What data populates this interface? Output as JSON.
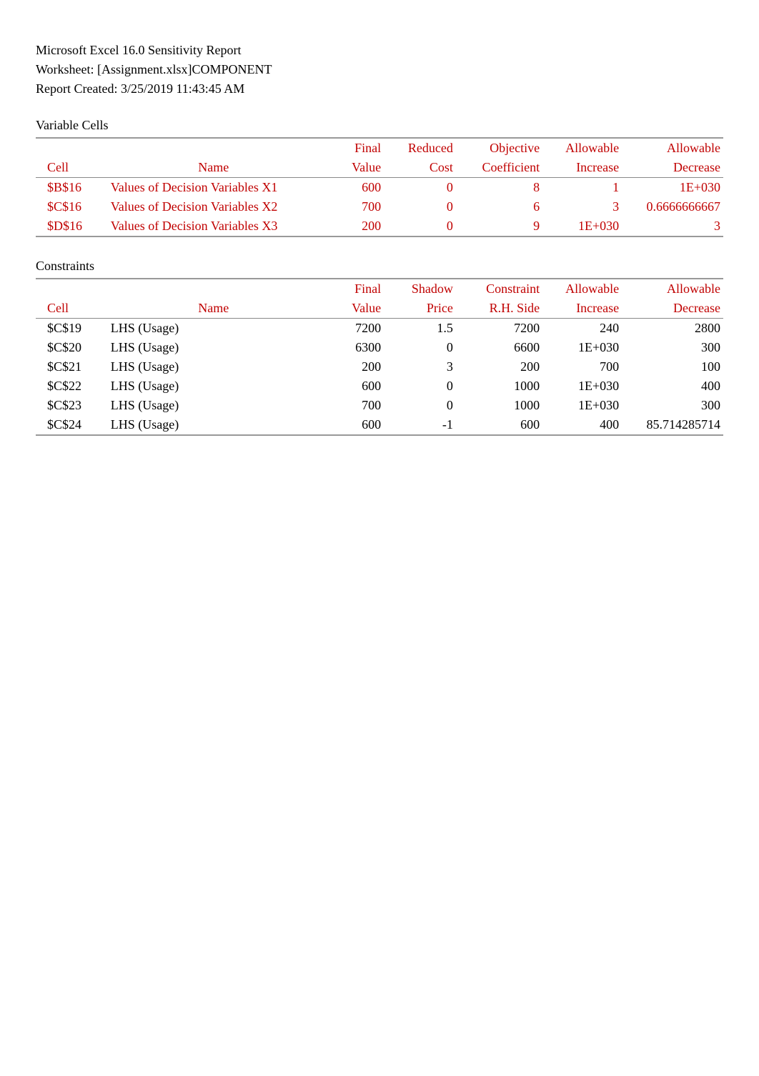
{
  "header": {
    "line1": "Microsoft Excel 16.0 Sensitivity Report",
    "line2": "Worksheet: [Assignment.xlsx]COMPONENT",
    "line3": "Report Created: 3/25/2019 11:43:45 AM"
  },
  "variable_cells": {
    "title": "Variable Cells",
    "head1": {
      "c3": "Final",
      "c4": "Reduced",
      "c5": "Objective",
      "c6": "Allowable",
      "c7": "Allowable"
    },
    "head2": {
      "c1": "Cell",
      "c2": "Name",
      "c3": "Value",
      "c4": "Cost",
      "c5": "Coefficient",
      "c6": "Increase",
      "c7": "Decrease"
    },
    "rows": [
      {
        "cell": "$B$16",
        "name": "Values of Decision Variables X1",
        "final": "600",
        "reduced": "0",
        "obj": "8",
        "inc": "1",
        "dec": "1E+030"
      },
      {
        "cell": "$C$16",
        "name": "Values of Decision Variables X2",
        "final": "700",
        "reduced": "0",
        "obj": "6",
        "inc": "3",
        "dec": "0.6666666667"
      },
      {
        "cell": "$D$16",
        "name": "Values of Decision Variables X3",
        "final": "200",
        "reduced": "0",
        "obj": "9",
        "inc": "1E+030",
        "dec": "3"
      }
    ]
  },
  "constraints": {
    "title": "Constraints",
    "head1": {
      "c3": "Final",
      "c4": "Shadow",
      "c5": "Constraint",
      "c6": "Allowable",
      "c7": "Allowable"
    },
    "head2": {
      "c1": "Cell",
      "c2": "Name",
      "c3": "Value",
      "c4": "Price",
      "c5": "R.H. Side",
      "c6": "Increase",
      "c7": "Decrease"
    },
    "rows": [
      {
        "cell": "$C$19",
        "name": "LHS (Usage)",
        "final": "7200",
        "shadow": "1.5",
        "rhs": "7200",
        "inc": "240",
        "dec": "2800"
      },
      {
        "cell": "$C$20",
        "name": "LHS (Usage)",
        "final": "6300",
        "shadow": "0",
        "rhs": "6600",
        "inc": "1E+030",
        "dec": "300"
      },
      {
        "cell": "$C$21",
        "name": "LHS (Usage)",
        "final": "200",
        "shadow": "3",
        "rhs": "200",
        "inc": "700",
        "dec": "100"
      },
      {
        "cell": "$C$22",
        "name": "LHS (Usage)",
        "final": "600",
        "shadow": "0",
        "rhs": "1000",
        "inc": "1E+030",
        "dec": "400"
      },
      {
        "cell": "$C$23",
        "name": "LHS (Usage)",
        "final": "700",
        "shadow": "0",
        "rhs": "1000",
        "inc": "1E+030",
        "dec": "300"
      },
      {
        "cell": "$C$24",
        "name": "LHS (Usage)",
        "final": "600",
        "shadow": "-1",
        "rhs": "600",
        "inc": "400",
        "dec": "85.714285714"
      }
    ]
  }
}
